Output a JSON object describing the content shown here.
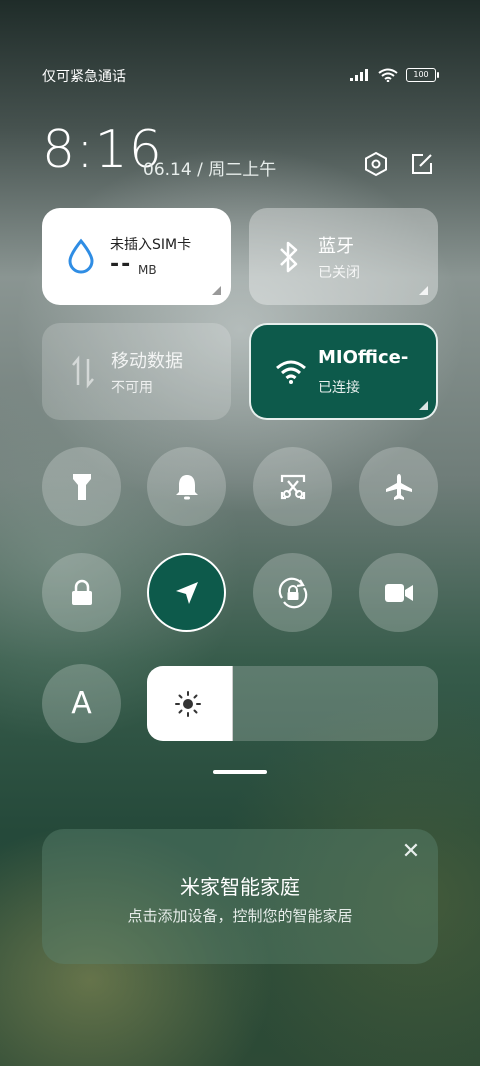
{
  "status_bar": {
    "carrier_text": "仅可紧急通话",
    "battery_level": "100"
  },
  "header": {
    "time": "8:16",
    "date": "06.14 / 周二上午"
  },
  "tiles": {
    "data": {
      "title": "未插入SIM卡",
      "value": "--",
      "unit": "MB"
    },
    "bluetooth": {
      "title": "蓝牙",
      "status": "已关闭"
    },
    "mobile_data": {
      "title": "移动数据",
      "status": "不可用"
    },
    "wifi": {
      "title": "MIOffice-",
      "status": "已连接"
    }
  },
  "toggles": [
    {
      "icon": "flashlight-icon",
      "active": false
    },
    {
      "icon": "bell-icon",
      "active": false
    },
    {
      "icon": "screenshot-icon",
      "active": false
    },
    {
      "icon": "airplane-icon",
      "active": false
    },
    {
      "icon": "lock-icon",
      "active": false
    },
    {
      "icon": "location-icon",
      "active": true
    },
    {
      "icon": "rotation-lock-icon",
      "active": false
    },
    {
      "icon": "video-camera-icon",
      "active": false
    }
  ],
  "auto_brightness_label": "A",
  "brightness_level": 0.2,
  "smart_home_card": {
    "title": "米家智能家庭",
    "subtitle": "点击添加设备，控制您的智能家居",
    "close_symbol": "✕"
  },
  "colors": {
    "accent": "#0d5a4b",
    "tile_white": "#ffffff",
    "data_icon": "#2f8de4"
  }
}
